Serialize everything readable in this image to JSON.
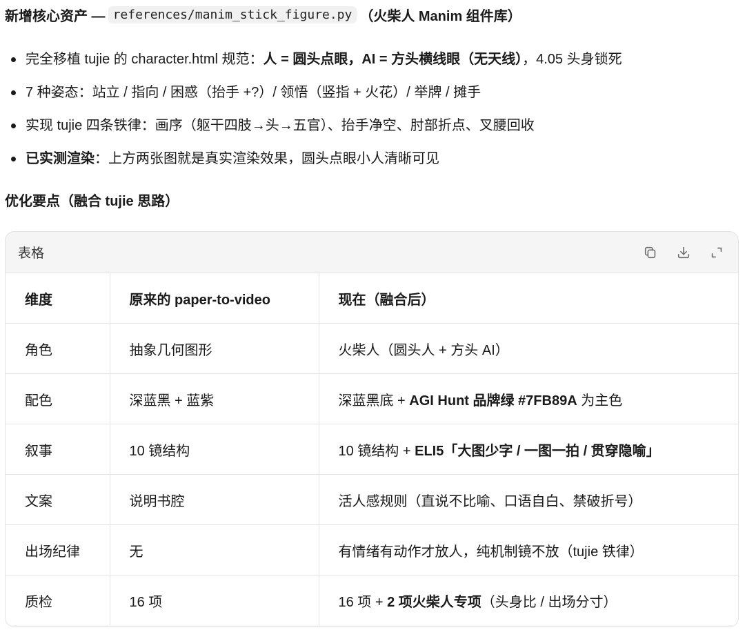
{
  "heading1": {
    "prefix": "新增核心资产 —",
    "code": "references/manim_stick_figure.py",
    "suffix": "（火柴人 Manim 组件库）"
  },
  "bullets": [
    {
      "t1": "完全移植 tujie 的 character.html 规范：",
      "b1": "人 = 圆头点眼，AI = 方头横线眼（无天线）",
      "t2": "，4.05 头身锁死"
    },
    {
      "t1": "7 种姿态：站立 / 指向 / 困惑（抬手 +?）/ 领悟（竖指 + 火花）/ 举牌 / 摊手"
    },
    {
      "t1": "实现 tujie 四条铁律：画序（躯干四肢→头→五官）、抬手净空、肘部折点、叉腰回收"
    },
    {
      "b1": "已实测渲染",
      "t1": "：上方两张图就是真实渲染效果，圆头点眼小人清晰可见"
    }
  ],
  "heading2": "优化要点（融合 tujie 思路）",
  "table": {
    "title": "表格",
    "icons": [
      "copy-icon",
      "download-icon",
      "expand-icon"
    ],
    "headers": [
      "维度",
      "原来的 paper-to-video",
      "现在（融合后）"
    ],
    "rows": [
      {
        "c1": "角色",
        "c2": "抽象几何图形",
        "c3a": "火柴人（圆头人 + 方头 AI）"
      },
      {
        "c1": "配色",
        "c2": "深蓝黑 + 蓝紫",
        "c3a": "深蓝黑底 + ",
        "c3b": "AGI Hunt 品牌绿 #7FB89A",
        "c3c": " 为主色"
      },
      {
        "c1": "叙事",
        "c2": "10 镜结构",
        "c3a": "10 镜结构 + ",
        "c3b": "ELI5「大图少字 / 一图一拍 / 贯穿隐喻」"
      },
      {
        "c1": "文案",
        "c2": "说明书腔",
        "c3a": "活人感规则（直说不比喻、口语自白、禁破折号）"
      },
      {
        "c1": "出场纪律",
        "c2": "无",
        "c3a": "有情绪有动作才放人，纯机制镜不放（tujie 铁律）"
      },
      {
        "c1": "质检",
        "c2": "16 项",
        "c3a": "16 项 + ",
        "c3b": "2 项火柴人专项",
        "c3c": "（头身比 / 出场分寸）"
      }
    ]
  }
}
